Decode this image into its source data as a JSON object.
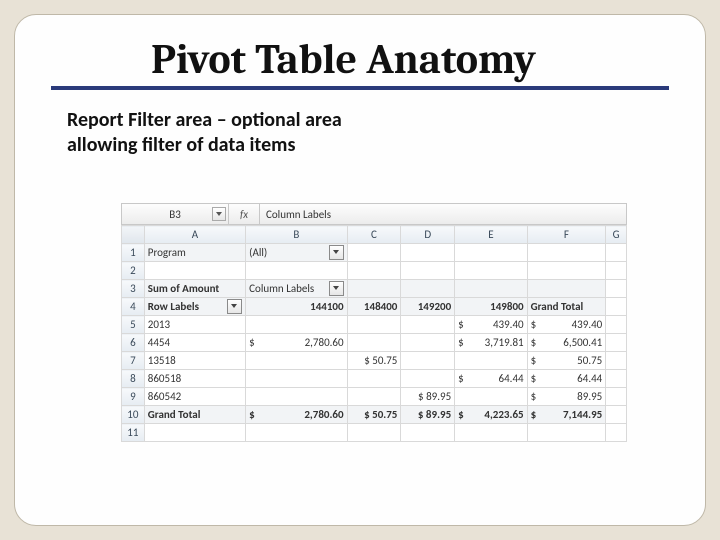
{
  "title": "Pivot Table Anatomy",
  "subtitle_l1": "Report Filter area – optional area",
  "subtitle_l2": "allowing filter of data items",
  "namebox": "B3",
  "fx_label": "fx",
  "fx_value": "Column Labels",
  "cols": {
    "A": "A",
    "B": "B",
    "C": "C",
    "D": "D",
    "E": "E",
    "F": "F",
    "G": "G"
  },
  "rownums": [
    "1",
    "2",
    "3",
    "4",
    "5",
    "6",
    "7",
    "8",
    "9",
    "10",
    "11"
  ],
  "r1": {
    "A": "Program",
    "B": "(All)"
  },
  "r3": {
    "A": "Sum of Amount",
    "B": "Column Labels"
  },
  "r4": {
    "A": "Row Labels",
    "B": "144100",
    "C": "148400",
    "D": "149200",
    "E": "149800",
    "F": "Grand Total"
  },
  "r5": {
    "A": "2013",
    "E_pre": "$",
    "E": "439.40",
    "F_pre": "$",
    "F": "439.40"
  },
  "r6": {
    "A": "4454",
    "B_pre": "$",
    "B": "2,780.60",
    "E_pre": "$",
    "E": "3,719.81",
    "F_pre": "$",
    "F": "6,500.41"
  },
  "r7": {
    "A": "13518",
    "C": "$ 50.75",
    "F_pre": "$",
    "F": "50.75"
  },
  "r8": {
    "A": "860518",
    "E_pre": "$",
    "E": "64.44",
    "F_pre": "$",
    "F": "64.44"
  },
  "r9": {
    "A": "860542",
    "D": "$ 89.95",
    "F_pre": "$",
    "F": "89.95"
  },
  "r10": {
    "A": "Grand Total",
    "B_pre": "$",
    "B": "2,780.60",
    "C": "$ 50.75",
    "D": "$ 89.95",
    "E_pre": "$",
    "E": "4,223.65",
    "F_pre": "$",
    "F": "7,144.95"
  }
}
